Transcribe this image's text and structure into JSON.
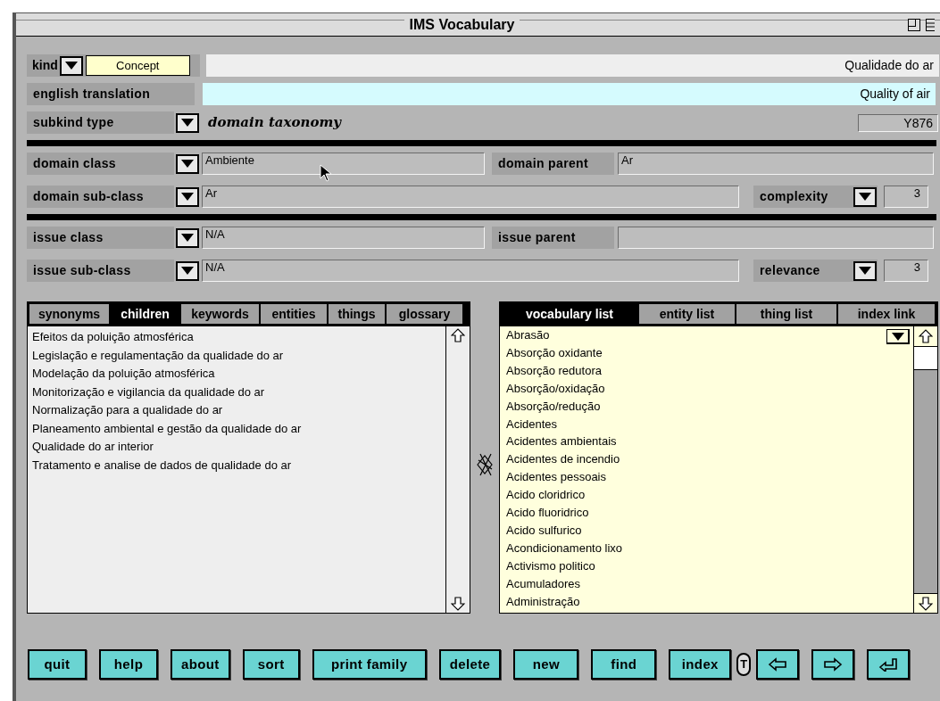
{
  "window": {
    "title": "IMS Vocabulary"
  },
  "header": {
    "kind_label": "kind",
    "kind_value": "Concept",
    "term": "Qualidade do ar",
    "translation_label": "english translation",
    "translation": "Quality of air",
    "subkind_label": "subkind type",
    "subkind_value": "domain taxonomy",
    "code": "Y876"
  },
  "domain": {
    "class_label": "domain class",
    "class_value": "Ambiente",
    "parent_label": "domain parent",
    "parent_value": "Ar",
    "subclass_label": "domain sub-class",
    "subclass_value": "Ar",
    "metric_label": "complexity",
    "metric_value": "3"
  },
  "issue": {
    "class_label": "issue class",
    "class_value": "N/A",
    "parent_label": "issue parent",
    "subclass_label": "issue sub-class",
    "subclass_value": "N/A",
    "metric_label": "relevance",
    "metric_value": "3"
  },
  "left_tabs": [
    {
      "label": "synonyms",
      "selected": false
    },
    {
      "label": "children",
      "selected": true
    },
    {
      "label": "keywords",
      "selected": false
    },
    {
      "label": "entities",
      "selected": false
    },
    {
      "label": "things",
      "selected": false
    },
    {
      "label": "glossary",
      "selected": false
    }
  ],
  "left_list": [
    "Efeitos da poluição atmosférica",
    "Legislação e regulamentação da qualidade do ar",
    "Modelação da poluição atmosférica",
    "Monitorização e vigilancia da qualidade do ar",
    "Normalização para a qualidade do ar",
    "Planeamento ambiental e gestão da qualidade do ar",
    "Qualidade do ar interior",
    "Tratamento e analise de dados de qualidade do ar"
  ],
  "right_tabs": [
    {
      "label": "vocabulary list",
      "selected": true
    },
    {
      "label": "entity list",
      "selected": false
    },
    {
      "label": "thing list",
      "selected": false
    },
    {
      "label": "index link",
      "selected": false
    }
  ],
  "right_list": [
    "Abrasão",
    "Absorção oxidante",
    "Absorção redutora",
    "Absorção/oxidação",
    "Absorção/redução",
    "Acidentes",
    "Acidentes ambientais",
    "Acidentes de incendio",
    "Acidentes pessoais",
    "Acido cloridrico",
    "Acido fluoridrico",
    "Acido sulfurico",
    "Acondicionamento lixo",
    "Activismo politico",
    "Acumuladores",
    "Administração"
  ],
  "buttons": [
    "quit",
    "help",
    "about",
    "sort",
    "print family",
    "delete",
    "new",
    "find",
    "index"
  ],
  "t_badge": "T"
}
